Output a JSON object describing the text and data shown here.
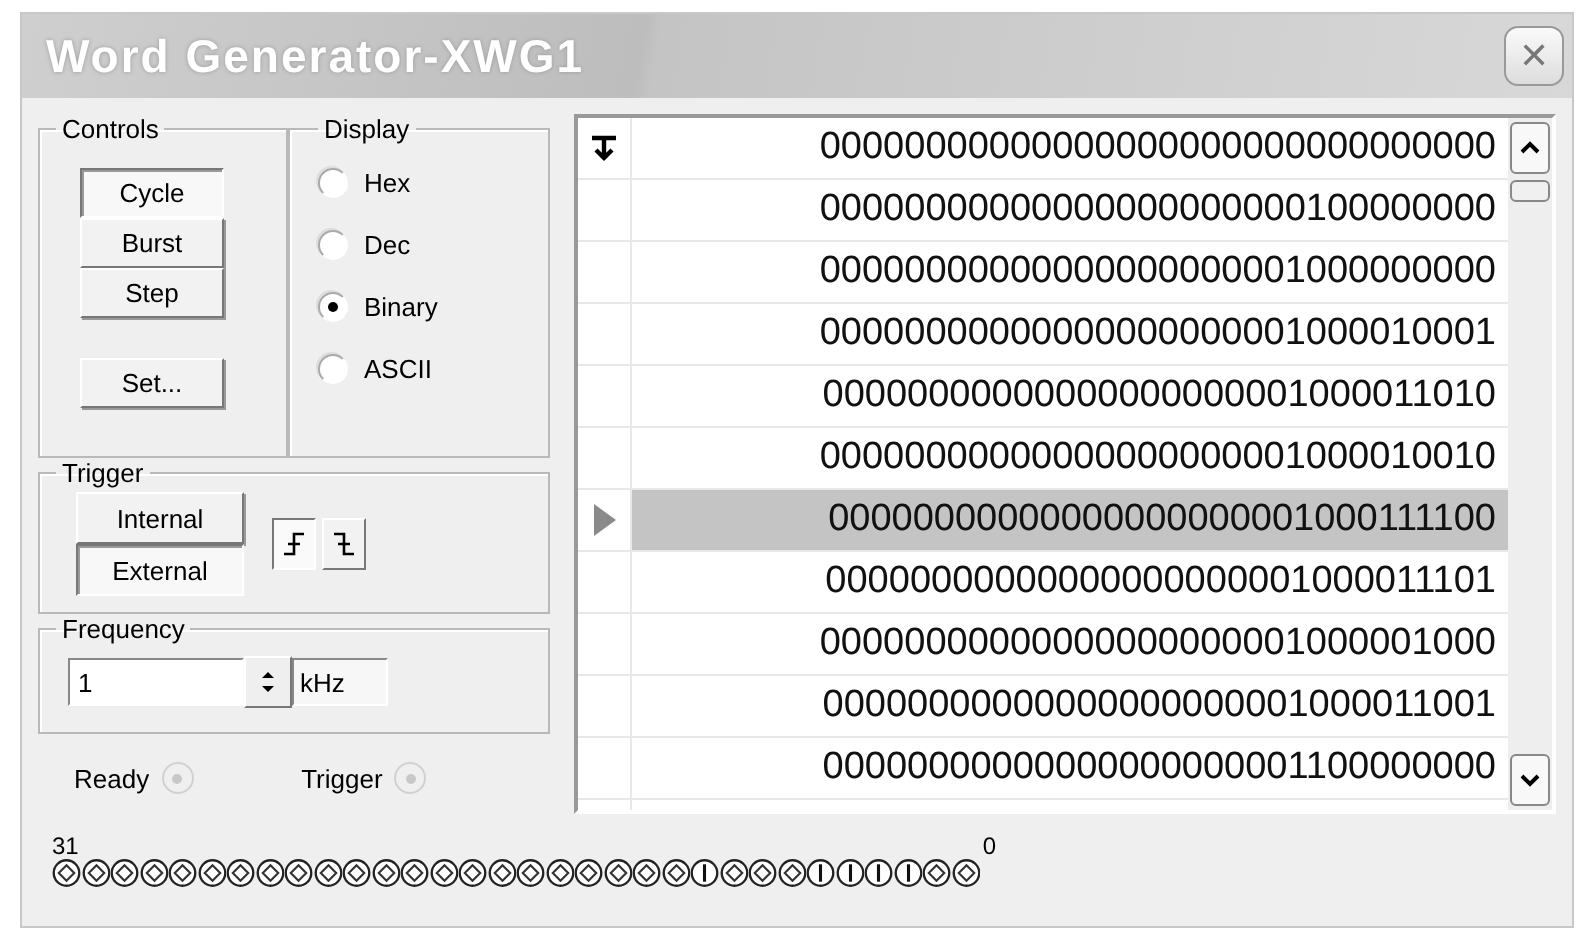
{
  "window": {
    "title": "Word Generator-XWG1",
    "close": "✕"
  },
  "controls": {
    "label": "Controls",
    "modes": [
      {
        "label": "Cycle",
        "selected": true
      },
      {
        "label": "Burst",
        "selected": false
      },
      {
        "label": "Step",
        "selected": false
      }
    ],
    "set_button": "Set..."
  },
  "display": {
    "label": "Display",
    "options": [
      {
        "label": "Hex",
        "selected": false
      },
      {
        "label": "Dec",
        "selected": false
      },
      {
        "label": "Binary",
        "selected": true
      },
      {
        "label": "ASCII",
        "selected": false
      }
    ]
  },
  "trigger": {
    "label": "Trigger",
    "sources": [
      {
        "label": "Internal",
        "selected": false
      },
      {
        "label": "External",
        "selected": true
      }
    ],
    "edges": [
      {
        "kind": "rising",
        "selected": true
      },
      {
        "kind": "falling",
        "selected": false
      }
    ]
  },
  "frequency": {
    "label": "Frequency",
    "value": "1",
    "unit": "kHz"
  },
  "indicators": [
    {
      "label": "Ready",
      "on": false
    },
    {
      "label": "Trigger",
      "on": false
    }
  ],
  "words": [
    {
      "value": "00000000000000000000000000000000",
      "initial": true,
      "selected": false
    },
    {
      "value": "00000000000000000000000100000000",
      "initial": false,
      "selected": false
    },
    {
      "value": "00000000000000000000001000000000",
      "initial": false,
      "selected": false
    },
    {
      "value": "00000000000000000000001000010001",
      "initial": false,
      "selected": false
    },
    {
      "value": "00000000000000000000001000011010",
      "initial": false,
      "selected": false
    },
    {
      "value": "00000000000000000000001000010010",
      "initial": false,
      "selected": false
    },
    {
      "value": "00000000000000000000001000111100",
      "initial": false,
      "selected": true
    },
    {
      "value": "00000000000000000000001000011101",
      "initial": false,
      "selected": false
    },
    {
      "value": "00000000000000000000001000001000",
      "initial": false,
      "selected": false
    },
    {
      "value": "00000000000000000000001000011001",
      "initial": false,
      "selected": false
    },
    {
      "value": "00000000000000000000001100000000",
      "initial": false,
      "selected": false
    }
  ],
  "bit_labels": {
    "high": "31",
    "low": "0"
  },
  "bits": [
    {
      "on": false
    },
    {
      "on": false
    },
    {
      "on": false
    },
    {
      "on": false
    },
    {
      "on": false
    },
    {
      "on": false
    },
    {
      "on": false
    },
    {
      "on": false
    },
    {
      "on": false
    },
    {
      "on": false
    },
    {
      "on": false
    },
    {
      "on": false
    },
    {
      "on": false
    },
    {
      "on": false
    },
    {
      "on": false
    },
    {
      "on": false
    },
    {
      "on": false
    },
    {
      "on": false
    },
    {
      "on": false
    },
    {
      "on": false
    },
    {
      "on": false
    },
    {
      "on": false
    },
    {
      "on": true
    },
    {
      "on": false
    },
    {
      "on": false
    },
    {
      "on": false
    },
    {
      "on": true
    },
    {
      "on": true
    },
    {
      "on": true
    },
    {
      "on": true
    },
    {
      "on": false
    },
    {
      "on": false
    }
  ]
}
